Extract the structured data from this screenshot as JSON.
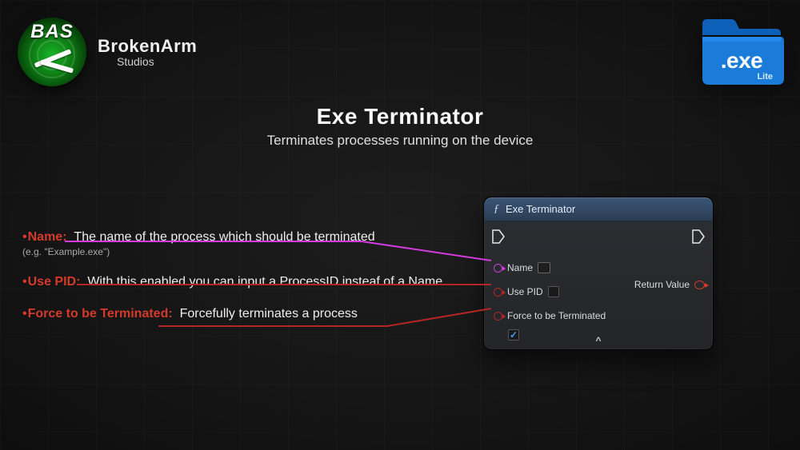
{
  "brand": {
    "badge_text": "BAS",
    "title": "BrokenArm",
    "subtitle": "Studios"
  },
  "exe_badge": {
    "label": ".exe",
    "lite": "Lite"
  },
  "page": {
    "title": "Exe Terminator",
    "subtitle": "Terminates processes running on the device"
  },
  "descriptions": {
    "name": {
      "key": "Name:",
      "text": "The name of the process which should be terminated",
      "note": "(e.g. \"Example.exe\")"
    },
    "use_pid": {
      "key": "Use PID:",
      "text": "With this enabled you can input a ProcessID insteaf of a Name"
    },
    "force": {
      "key": "Force to be Terminated:",
      "text": "Forcefully terminates a process"
    }
  },
  "node": {
    "title": "Exe Terminator",
    "func_glyph": "ƒ",
    "inputs": {
      "name_label": "Name",
      "use_pid_label": "Use PID",
      "force_label": "Force to be Terminated",
      "force_checked": true
    },
    "outputs": {
      "return_label": "Return Value"
    },
    "expand_glyph": "^"
  },
  "colors": {
    "accent_red": "#d43a2a",
    "accent_magenta": "#d33adf",
    "node_header": "#3a5576"
  }
}
